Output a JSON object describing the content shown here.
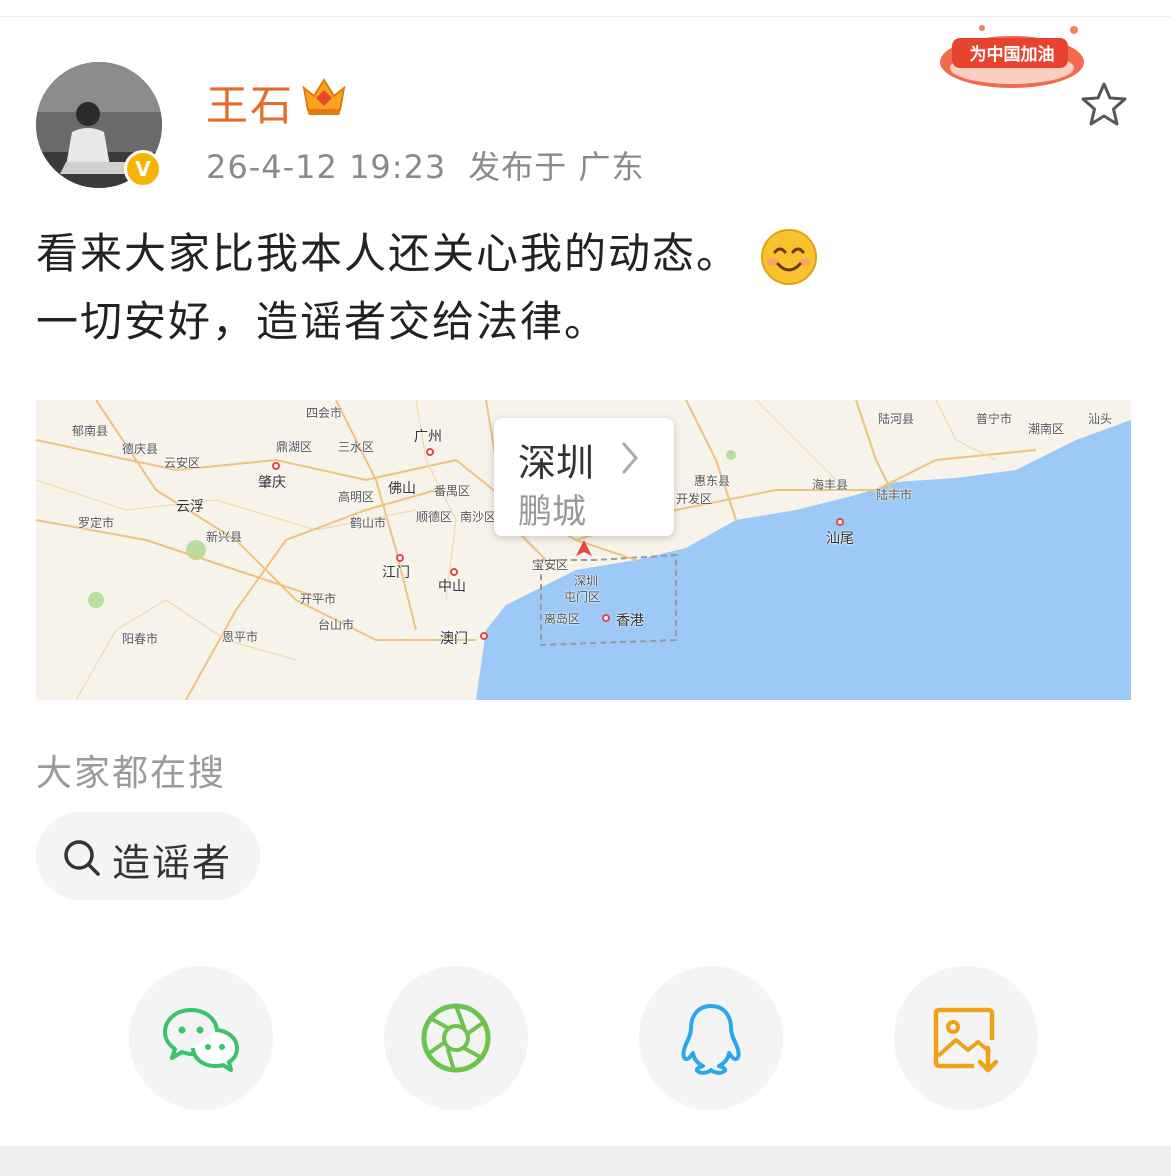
{
  "post": {
    "author": {
      "name": "王石",
      "verified": true,
      "verified_badge": "V"
    },
    "time": "26-4-12 19:23",
    "location": "发布于 广东",
    "badge_text": "为中国加油",
    "text_line1": "看来大家比我本人还关心我的动态。",
    "text_line2": "一切安好，造谣者交给法律。",
    "emoji": "smiling-face"
  },
  "map": {
    "popup_city": "深圳",
    "popup_sub": "鹏城",
    "labels": {
      "l1": "郁南县",
      "l2": "德庆县",
      "l3": "云安区",
      "l4": "肇庆",
      "l5": "云浮",
      "l6": "罗定市",
      "l7": "新兴县",
      "l8": "四会市",
      "l9": "鼎湖区",
      "l10": "三水区",
      "l11": "广州",
      "l12": "佛山",
      "l13": "番禺区",
      "l14": "高明区",
      "l15": "鹤山市",
      "l16": "顺德区",
      "l17": "南沙区",
      "l18": "江门",
      "l19": "中山",
      "l20": "开平市",
      "l21": "台山市",
      "l22": "恩平市",
      "l23": "阳春市",
      "l24": "澳门",
      "l25": "宝安区",
      "l26": "深圳",
      "l27": "屯门区",
      "l28": "离岛区",
      "l29": "香港",
      "l30": "惠东县",
      "l31": "开发区",
      "l32": "海丰县",
      "l33": "陆丰市",
      "l34": "汕尾",
      "l35": "陆河县",
      "l36": "普宁市",
      "l37": "潮南区",
      "l38": "汕头"
    }
  },
  "search": {
    "title": "大家都在搜",
    "chip": "造谣者"
  },
  "share": {
    "items": [
      "wechat",
      "moments",
      "qq",
      "save-image"
    ]
  },
  "colors": {
    "username": "#e8692c",
    "accent_badge": "#f7b500",
    "sea": "#9cc9f6",
    "wechat": "#39c36b",
    "qq": "#2aa6ef",
    "save": "#f0a11a"
  }
}
